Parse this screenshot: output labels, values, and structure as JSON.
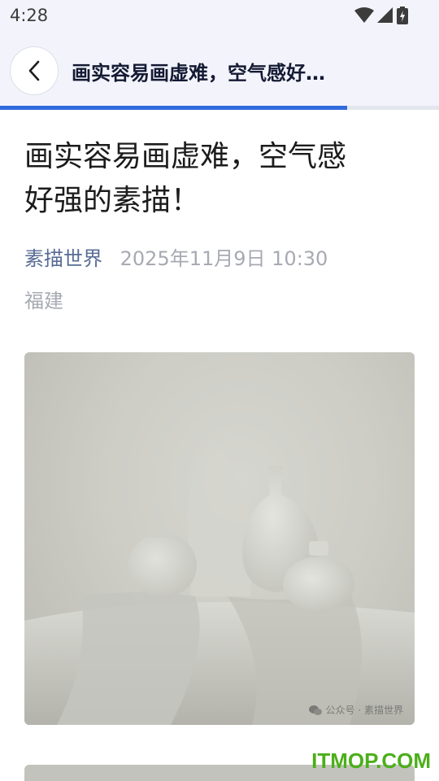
{
  "status_bar": {
    "time": "4:28"
  },
  "app_bar": {
    "title": "画实容易画虚难，空气感好…"
  },
  "reading_progress": {
    "fraction": 0.79
  },
  "article": {
    "title_line1": "画实容易画虚难，空气感",
    "title_line2": "好强的素描！",
    "author": "素描世界",
    "date": "2025年11月9日 10:30",
    "location": "福建"
  },
  "image": {
    "watermark_text": "公众号 · 素描世界"
  },
  "site_watermark": "ITMOP.COM",
  "colors": {
    "accent": "#2f6bdc",
    "author_link": "#576b95",
    "meta_gray": "#a7aab2",
    "site_watermark": "#4caf1a"
  }
}
